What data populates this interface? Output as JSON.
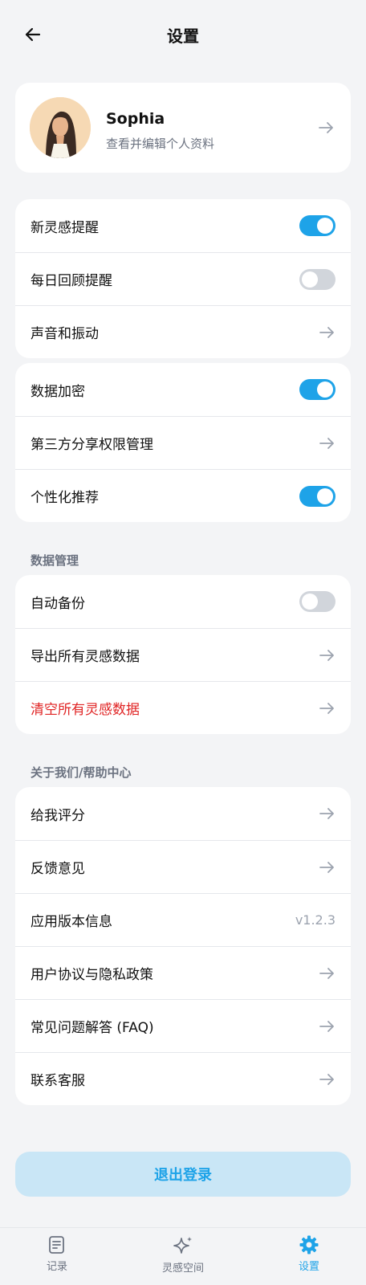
{
  "header": {
    "title": "设置",
    "back_icon": "arrow-left-icon"
  },
  "profile": {
    "name": "Sophia",
    "subtitle": "查看并编辑个人资料"
  },
  "group1": [
    {
      "label": "新灵感提醒",
      "control": "toggle",
      "on": true
    },
    {
      "label": "每日回顾提醒",
      "control": "toggle",
      "on": false
    },
    {
      "label": "声音和振动",
      "control": "arrow"
    }
  ],
  "group2": [
    {
      "label": "数据加密",
      "control": "toggle",
      "on": true
    },
    {
      "label": "第三方分享权限管理",
      "control": "arrow"
    },
    {
      "label": "个性化推荐",
      "control": "toggle",
      "on": true
    }
  ],
  "data_section": {
    "title": "数据管理",
    "items": [
      {
        "label": "自动备份",
        "control": "toggle",
        "on": false
      },
      {
        "label": "导出所有灵感数据",
        "control": "arrow"
      },
      {
        "label": "清空所有灵感数据",
        "control": "arrow",
        "danger": true
      }
    ]
  },
  "about_section": {
    "title": "关于我们/帮助中心",
    "items": [
      {
        "label": "给我评分",
        "control": "arrow"
      },
      {
        "label": "反馈意见",
        "control": "arrow"
      },
      {
        "label": "应用版本信息",
        "control": "value",
        "value": "v1.2.3"
      },
      {
        "label": "用户协议与隐私政策",
        "control": "arrow"
      },
      {
        "label": "常见问题解答 (FAQ)",
        "control": "arrow"
      },
      {
        "label": "联系客服",
        "control": "arrow"
      }
    ]
  },
  "logout": {
    "label": "退出登录"
  },
  "tabbar": {
    "tabs": [
      {
        "label": "记录",
        "icon": "note-icon",
        "active": false
      },
      {
        "label": "灵感空间",
        "icon": "sparkle-icon",
        "active": false
      },
      {
        "label": "设置",
        "icon": "gear-icon",
        "active": true
      }
    ]
  },
  "colors": {
    "accent": "#1ea3e8",
    "danger": "#e02424",
    "toggle_off": "#d1d5db"
  }
}
